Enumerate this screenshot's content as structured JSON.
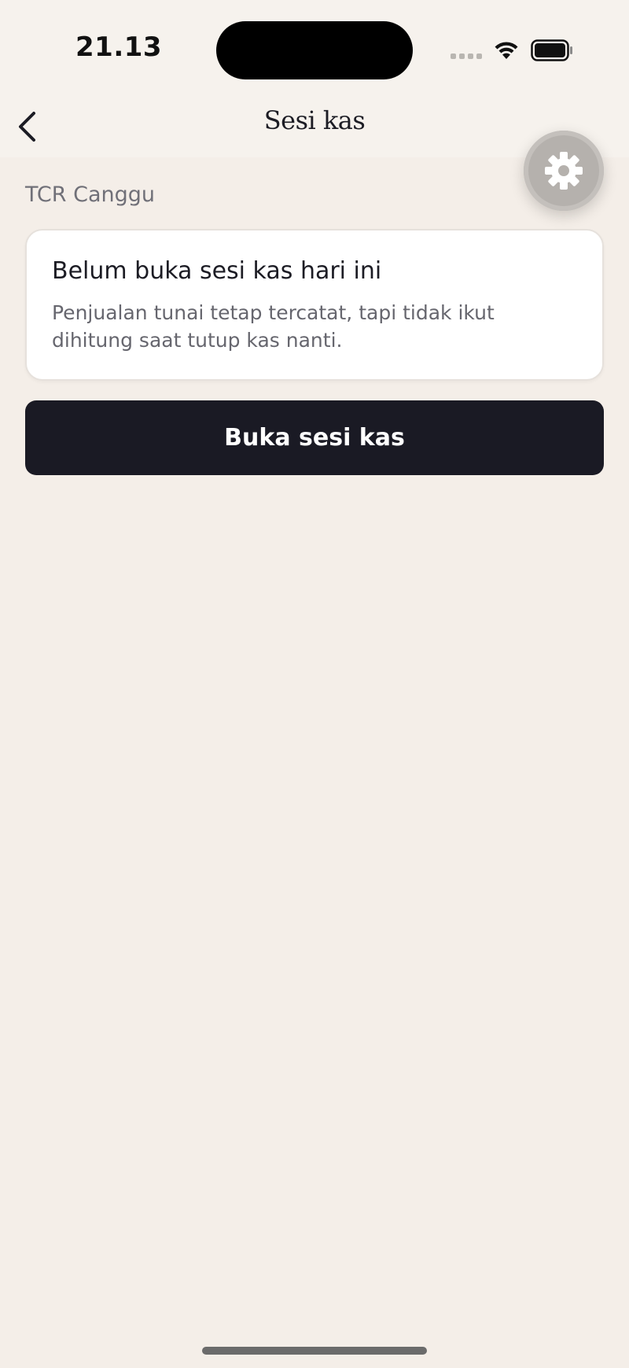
{
  "status_bar": {
    "time": "21.13"
  },
  "nav": {
    "title": "Sesi kas",
    "back_icon": "chevron-left-icon"
  },
  "fab": {
    "icon": "gear-icon"
  },
  "store": {
    "name": "TCR Canggu"
  },
  "notice_card": {
    "title": "Belum buka sesi kas hari ini",
    "body": "Penjualan tunai tetap tercatat, tapi tidak ikut dihitung saat tutup kas nanti."
  },
  "actions": {
    "open_session_label": "Buka sesi kas"
  },
  "colors": {
    "background": "#f4eee8",
    "primary_button": "#1a1a24",
    "card": "#ffffff"
  }
}
